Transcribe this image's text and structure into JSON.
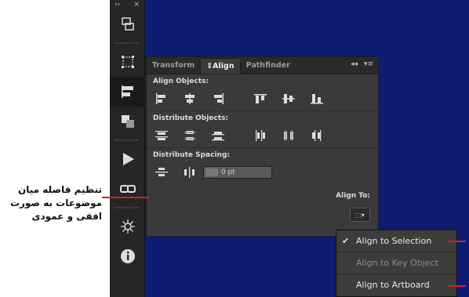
{
  "panel": {
    "tabs": [
      "Transform",
      "Align",
      "Pathfinder"
    ],
    "active_tab": "Align",
    "collapse_icon": "double-left-chevron-icon",
    "menu_icon": "panel-menu-icon",
    "sections": {
      "align_objects": "Align Objects:",
      "distribute_objects": "Distribute Objects:",
      "distribute_spacing": "Distribute Spacing:"
    },
    "spacing_value": "0 pt",
    "align_to_label": "Align To:"
  },
  "toolbar": {
    "close_label": "×",
    "collapse_label": "››",
    "tools": [
      "artboard-icon",
      "transform-icon",
      "align-icon",
      "pathfinder-icon",
      "play-action-icon",
      "link-icon",
      "symbol-icon",
      "info-icon"
    ]
  },
  "dropdown": {
    "items": [
      {
        "label": "Align to Selection",
        "checked": true,
        "enabled": true
      },
      {
        "label": "Align to Key Object",
        "checked": false,
        "enabled": false
      },
      {
        "label": "Align to Artboard",
        "checked": false,
        "enabled": true
      }
    ]
  },
  "annotation": {
    "lines": [
      "تنظیم فاصله میان",
      "موضوعات به صورت",
      "افقی و عمودی"
    ]
  },
  "colors": {
    "artboard": "#0e1c72",
    "panel_bg": "#3a3a3a",
    "callout_red": "#d61f1f"
  }
}
